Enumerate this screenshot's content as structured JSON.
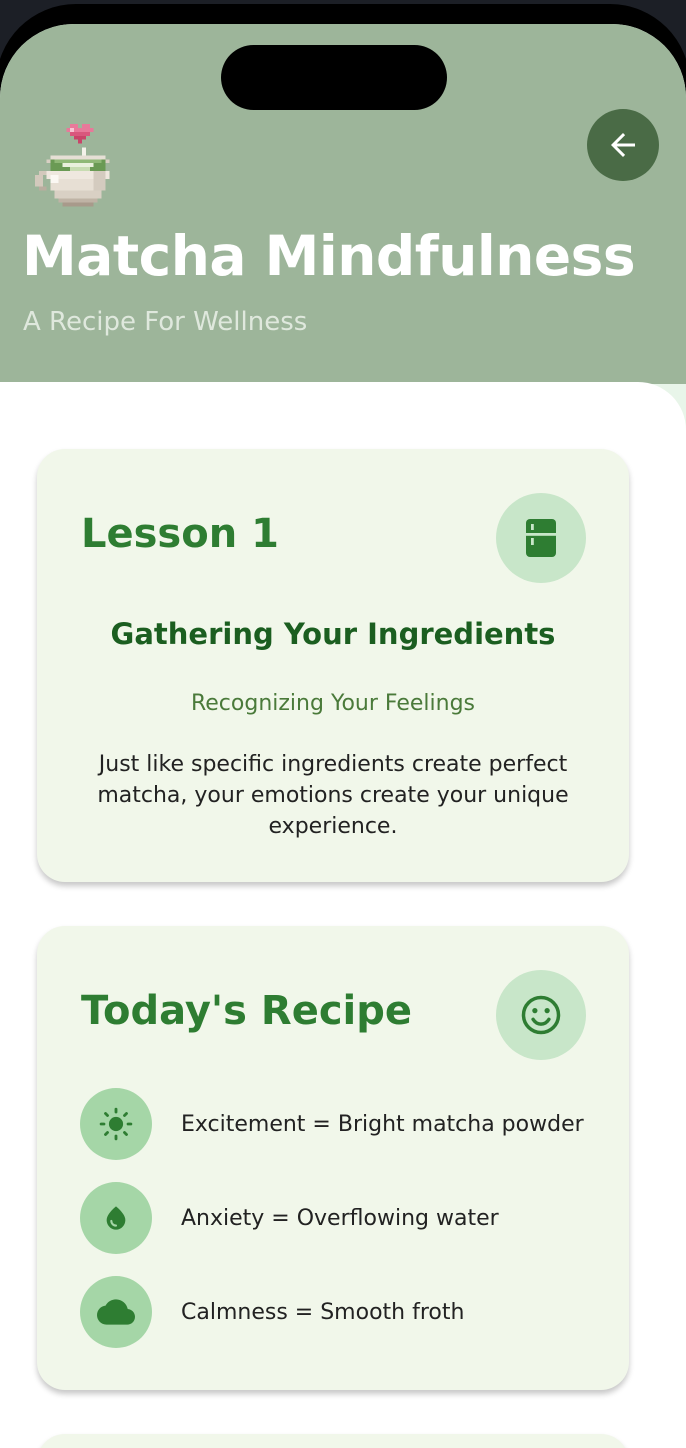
{
  "header": {
    "title": "Matcha Mindfulness",
    "subtitle": "A Recipe For Wellness",
    "back_icon": "arrow-left-icon",
    "illustration": "matcha-cup-heart-icon"
  },
  "lesson_card": {
    "heading": "Lesson 1",
    "icon": "fridge-icon",
    "title": "Gathering Your Ingredients",
    "subtitle": "Recognizing Your Feelings",
    "body": "Just like specific ingredients create perfect matcha, your emotions create your unique experience."
  },
  "recipe_card": {
    "heading": "Today's Recipe",
    "icon": "smiley-face-icon",
    "items": [
      {
        "icon": "sun-icon",
        "text": "Excitement = Bright matcha powder"
      },
      {
        "icon": "water-drop-icon",
        "text": "Anxiety = Overflowing water"
      },
      {
        "icon": "cloud-icon",
        "text": "Calmness = Smooth froth"
      }
    ]
  },
  "colors": {
    "header_bg": "#9db59a",
    "accent_green": "#2e7d32",
    "dark_green": "#1b5e20",
    "card_bg": "#f1f7ea",
    "icon_circle_light": "#c8e6c9",
    "icon_circle": "#a5d6a7",
    "back_button": "#4a6b46"
  }
}
